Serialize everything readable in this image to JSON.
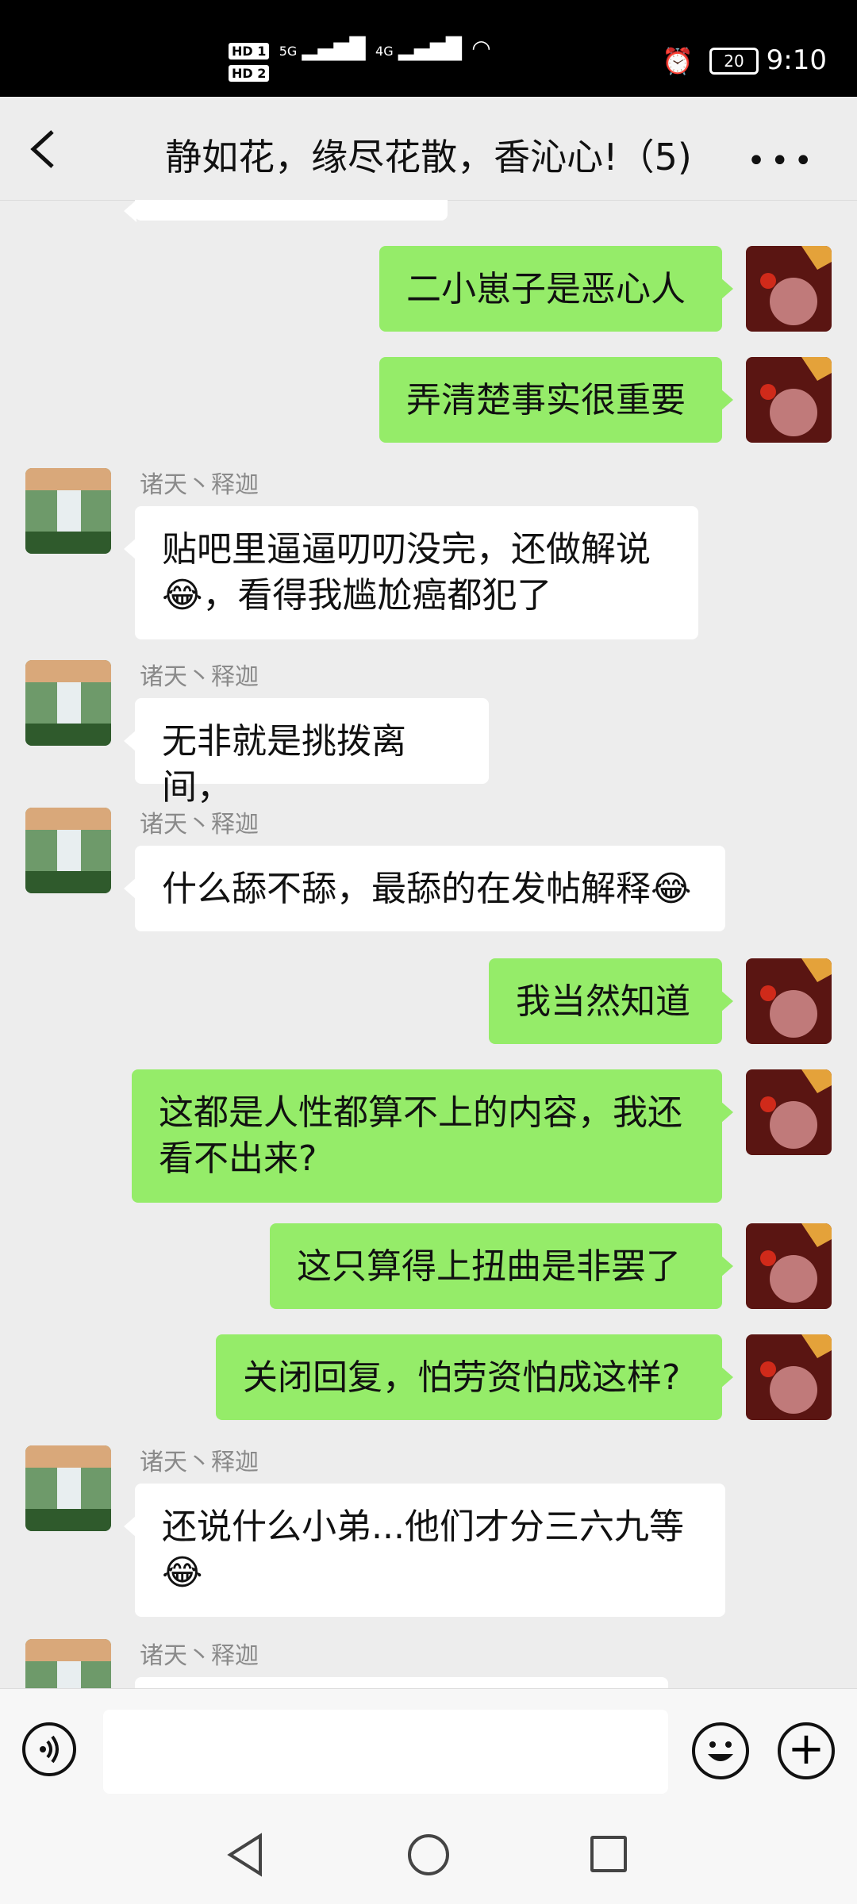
{
  "statusbar": {
    "sim1": "HD 1",
    "sim2": "HD 2",
    "net1": "5G",
    "net2": "4G",
    "battery": "20",
    "time": "9:10"
  },
  "header": {
    "title": "静如花，缘尽花散，香沁心!（5)"
  },
  "messages": [
    {
      "side": "me",
      "text": "二小崽子是恶心人"
    },
    {
      "side": "me",
      "text": "弄清楚事实很重要"
    },
    {
      "side": "other",
      "sender": "诸天丶释迦",
      "line1": "贴吧里逼逼叨叨没完，还做解说",
      "line2": "😂，看得我尴尬癌都犯了"
    },
    {
      "side": "other",
      "sender": "诸天丶释迦",
      "text": "无非就是挑拨离间，"
    },
    {
      "side": "other",
      "sender": "诸天丶释迦",
      "text": "什么舔不舔，最舔的在发帖解释😂"
    },
    {
      "side": "me",
      "text": "我当然知道"
    },
    {
      "side": "me",
      "line1": "这都是人性都算不上的内容，我还",
      "line2": "看不出来?"
    },
    {
      "side": "me",
      "text": "这只算得上扭曲是非罢了"
    },
    {
      "side": "me",
      "text": "关闭回复，怕劳资怕成这样?"
    },
    {
      "side": "other",
      "sender": "诸天丶释迦",
      "line1": "还说什么小弟...他们才分三六九等",
      "line2": "😂"
    },
    {
      "side": "other",
      "sender": "诸天丶释迦"
    }
  ]
}
